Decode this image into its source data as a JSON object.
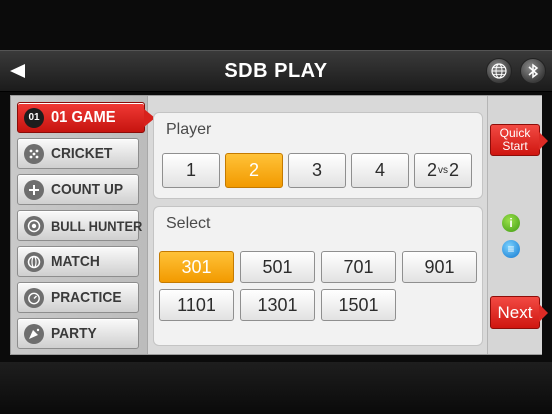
{
  "header": {
    "title": "SDB PLAY",
    "back_icon": "back-arrow-icon",
    "globe_icon": "globe-icon",
    "bluetooth_icon": "bluetooth-icon"
  },
  "sidebar": {
    "items": [
      {
        "label": "01 GAME",
        "icon": "01",
        "active": true
      },
      {
        "label": "CRICKET",
        "icon": "cricket-icon"
      },
      {
        "label": "COUNT UP",
        "icon": "plus-icon"
      },
      {
        "label": "BULL HUNTER",
        "icon": "target-icon"
      },
      {
        "label": "MATCH",
        "icon": "match-icon"
      },
      {
        "label": "PRACTICE",
        "icon": "timer-icon"
      },
      {
        "label": "PARTY",
        "icon": "party-icon"
      }
    ]
  },
  "player": {
    "title": "Player",
    "options": [
      "1",
      "2",
      "3",
      "4"
    ],
    "vs_option": {
      "left": "2",
      "mid": "vs",
      "right": "2"
    },
    "selected": "2"
  },
  "select": {
    "title": "Select",
    "options": [
      "301",
      "501",
      "701",
      "901",
      "1101",
      "1301",
      "1501"
    ],
    "selected": "301"
  },
  "right": {
    "quick_start": "Quick Start",
    "quick_line1": "Quick",
    "quick_line2": "Start",
    "next": "Next",
    "info_glyph": "i",
    "list_glyph": "≡"
  },
  "colors": {
    "accent_red": "#d8211c",
    "selected_orange": "#f5a200"
  }
}
